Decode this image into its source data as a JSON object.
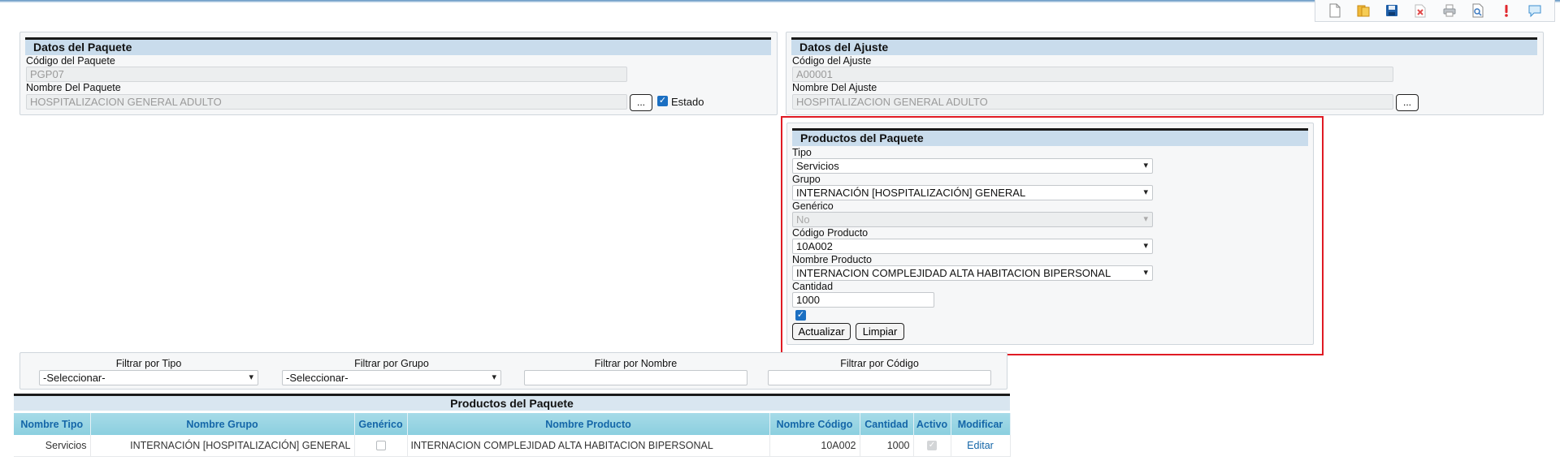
{
  "toolbar": {
    "icons": [
      "new-document-icon",
      "open-folder-icon",
      "save-icon",
      "delete-icon",
      "print-icon",
      "search-document-icon",
      "alert-icon",
      "chat-icon"
    ]
  },
  "paquete": {
    "section_title": "Datos del Paquete",
    "codigo_label": "Código del Paquete",
    "codigo_value": "PGP07",
    "nombre_label": "Nombre Del Paquete",
    "nombre_value": "HOSPITALIZACION GENERAL ADULTO",
    "browse_label": "...",
    "estado_label": "Estado",
    "estado_checked": true
  },
  "ajuste": {
    "section_title": "Datos del Ajuste",
    "codigo_label": "Código del Ajuste",
    "codigo_value": "A00001",
    "nombre_label": "Nombre Del Ajuste",
    "nombre_value": "HOSPITALIZACION GENERAL ADULTO",
    "browse_label": "..."
  },
  "productos_form": {
    "section_title": "Productos del Paquete",
    "tipo_label": "Tipo",
    "tipo_value": "Servicios",
    "grupo_label": "Grupo",
    "grupo_value": "INTERNACIÓN [HOSPITALIZACIÓN] GENERAL",
    "generico_label": "Genérico",
    "generico_value": "No",
    "codigo_label": "Código Producto",
    "codigo_value": "10A002",
    "nombre_label": "Nombre Producto",
    "nombre_value": "INTERNACION COMPLEJIDAD ALTA HABITACION BIPERSONAL",
    "cantidad_label": "Cantidad",
    "cantidad_value": "1000",
    "activo_checked": true,
    "actualizar_label": "Actualizar",
    "limpiar_label": "Limpiar"
  },
  "filters": {
    "tipo_label": "Filtrar por Tipo",
    "tipo_value": "-Seleccionar-",
    "grupo_label": "Filtrar por Grupo",
    "grupo_value": "-Seleccionar-",
    "nombre_label": "Filtrar por Nombre",
    "nombre_value": "",
    "codigo_label": "Filtrar por Código",
    "codigo_value": ""
  },
  "grid": {
    "title": "Productos del Paquete",
    "columns": [
      "Nombre Tipo",
      "Nombre Grupo",
      "Genérico",
      "Nombre Producto",
      "Nombre Código",
      "Cantidad",
      "Activo",
      "Modificar"
    ],
    "rows": [
      {
        "tipo": "Servicios",
        "grupo": "INTERNACIÓN [HOSPITALIZACIÓN] GENERAL",
        "generico": false,
        "producto": "INTERNACION COMPLEJIDAD ALTA HABITACION BIPERSONAL",
        "codigo": "10A002",
        "cantidad": "1000",
        "activo": true,
        "modificar": "Editar"
      }
    ]
  },
  "colors": {
    "accent": "#1b6fc2",
    "highlight_border": "#e01b24",
    "header_bg": "#c9dcec",
    "grid_header": "#8bcfdf"
  }
}
